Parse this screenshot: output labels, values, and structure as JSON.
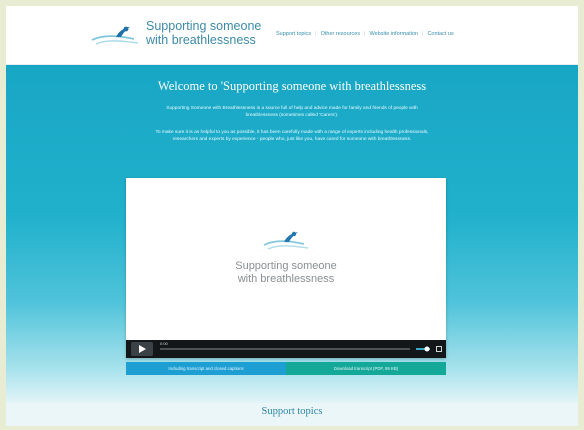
{
  "header": {
    "brand_line1": "Supporting someone",
    "brand_line2": "with breathlessness",
    "nav": [
      "Support topics",
      "Other resources",
      "Website information",
      "Contact us"
    ]
  },
  "hero": {
    "title": "Welcome to 'Supporting someone with breathlessness",
    "para1": "Supporting Someone with Breathlessness is a source full of help and advice made for family and friends of people with breathlessness (sometimes called 'Carers').",
    "para2": "To make sure it is as helpful to you as possible, it has been carefully made with a range of experts including health professionals, researchers and experts by experience - people who, just like you, have cared for someone with breathlessness."
  },
  "video": {
    "brand_line1": "Supporting someone",
    "brand_line2": "with breathlessness",
    "elapsed": "0:00",
    "progress": 0
  },
  "downloads": {
    "left": "Including transcript and closed captions",
    "right": "Download transcript (PDF, 89 KB)"
  },
  "lower": {
    "heading": "Support topics"
  },
  "colors": {
    "hero_top": "#18a6c5",
    "accent_blue": "#1e9fd4",
    "accent_teal": "#14a898",
    "brand_text": "#3c8aa9"
  }
}
